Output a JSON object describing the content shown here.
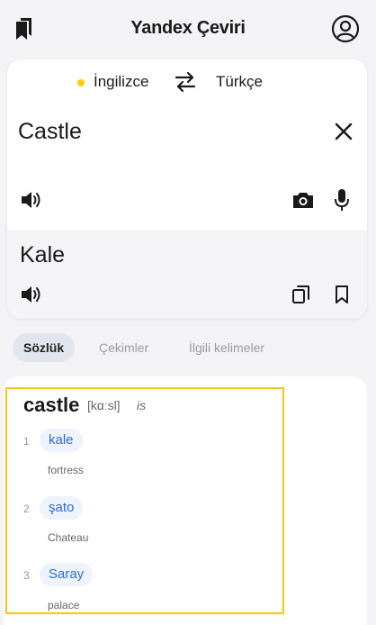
{
  "header": {
    "title": "Yandex Çeviri"
  },
  "languages": {
    "source": "İngilizce",
    "target": "Türkçe",
    "source_indicator_color": "#ffcc00"
  },
  "source": {
    "text": "Castle"
  },
  "translation": {
    "text": "Kale"
  },
  "tabs": [
    {
      "label": "Sözlük",
      "active": true
    },
    {
      "label": "Çekimler",
      "active": false
    },
    {
      "label": "İlgili kelimeler",
      "active": false
    }
  ],
  "dictionary": {
    "headword": "castle",
    "transcription": "[kɑːsl]",
    "pos": "is",
    "senses": [
      {
        "num": "1",
        "translation": "kale",
        "gloss": "fortress"
      },
      {
        "num": "2",
        "translation": "şato",
        "gloss": "Chateau"
      },
      {
        "num": "3",
        "translation": "Saray",
        "gloss": "palace"
      }
    ]
  },
  "colors": {
    "accent_blue": "#2f6bd8",
    "highlight_yellow": "#f2c814"
  },
  "icons": {
    "bookmarks": "bookmarks-icon",
    "account": "account-icon",
    "swap": "swap-languages-icon",
    "clear": "close-icon",
    "speaker": "speaker-icon",
    "camera": "camera-icon",
    "microphone": "microphone-icon",
    "copy": "copy-icon",
    "bookmark": "bookmark-icon"
  }
}
